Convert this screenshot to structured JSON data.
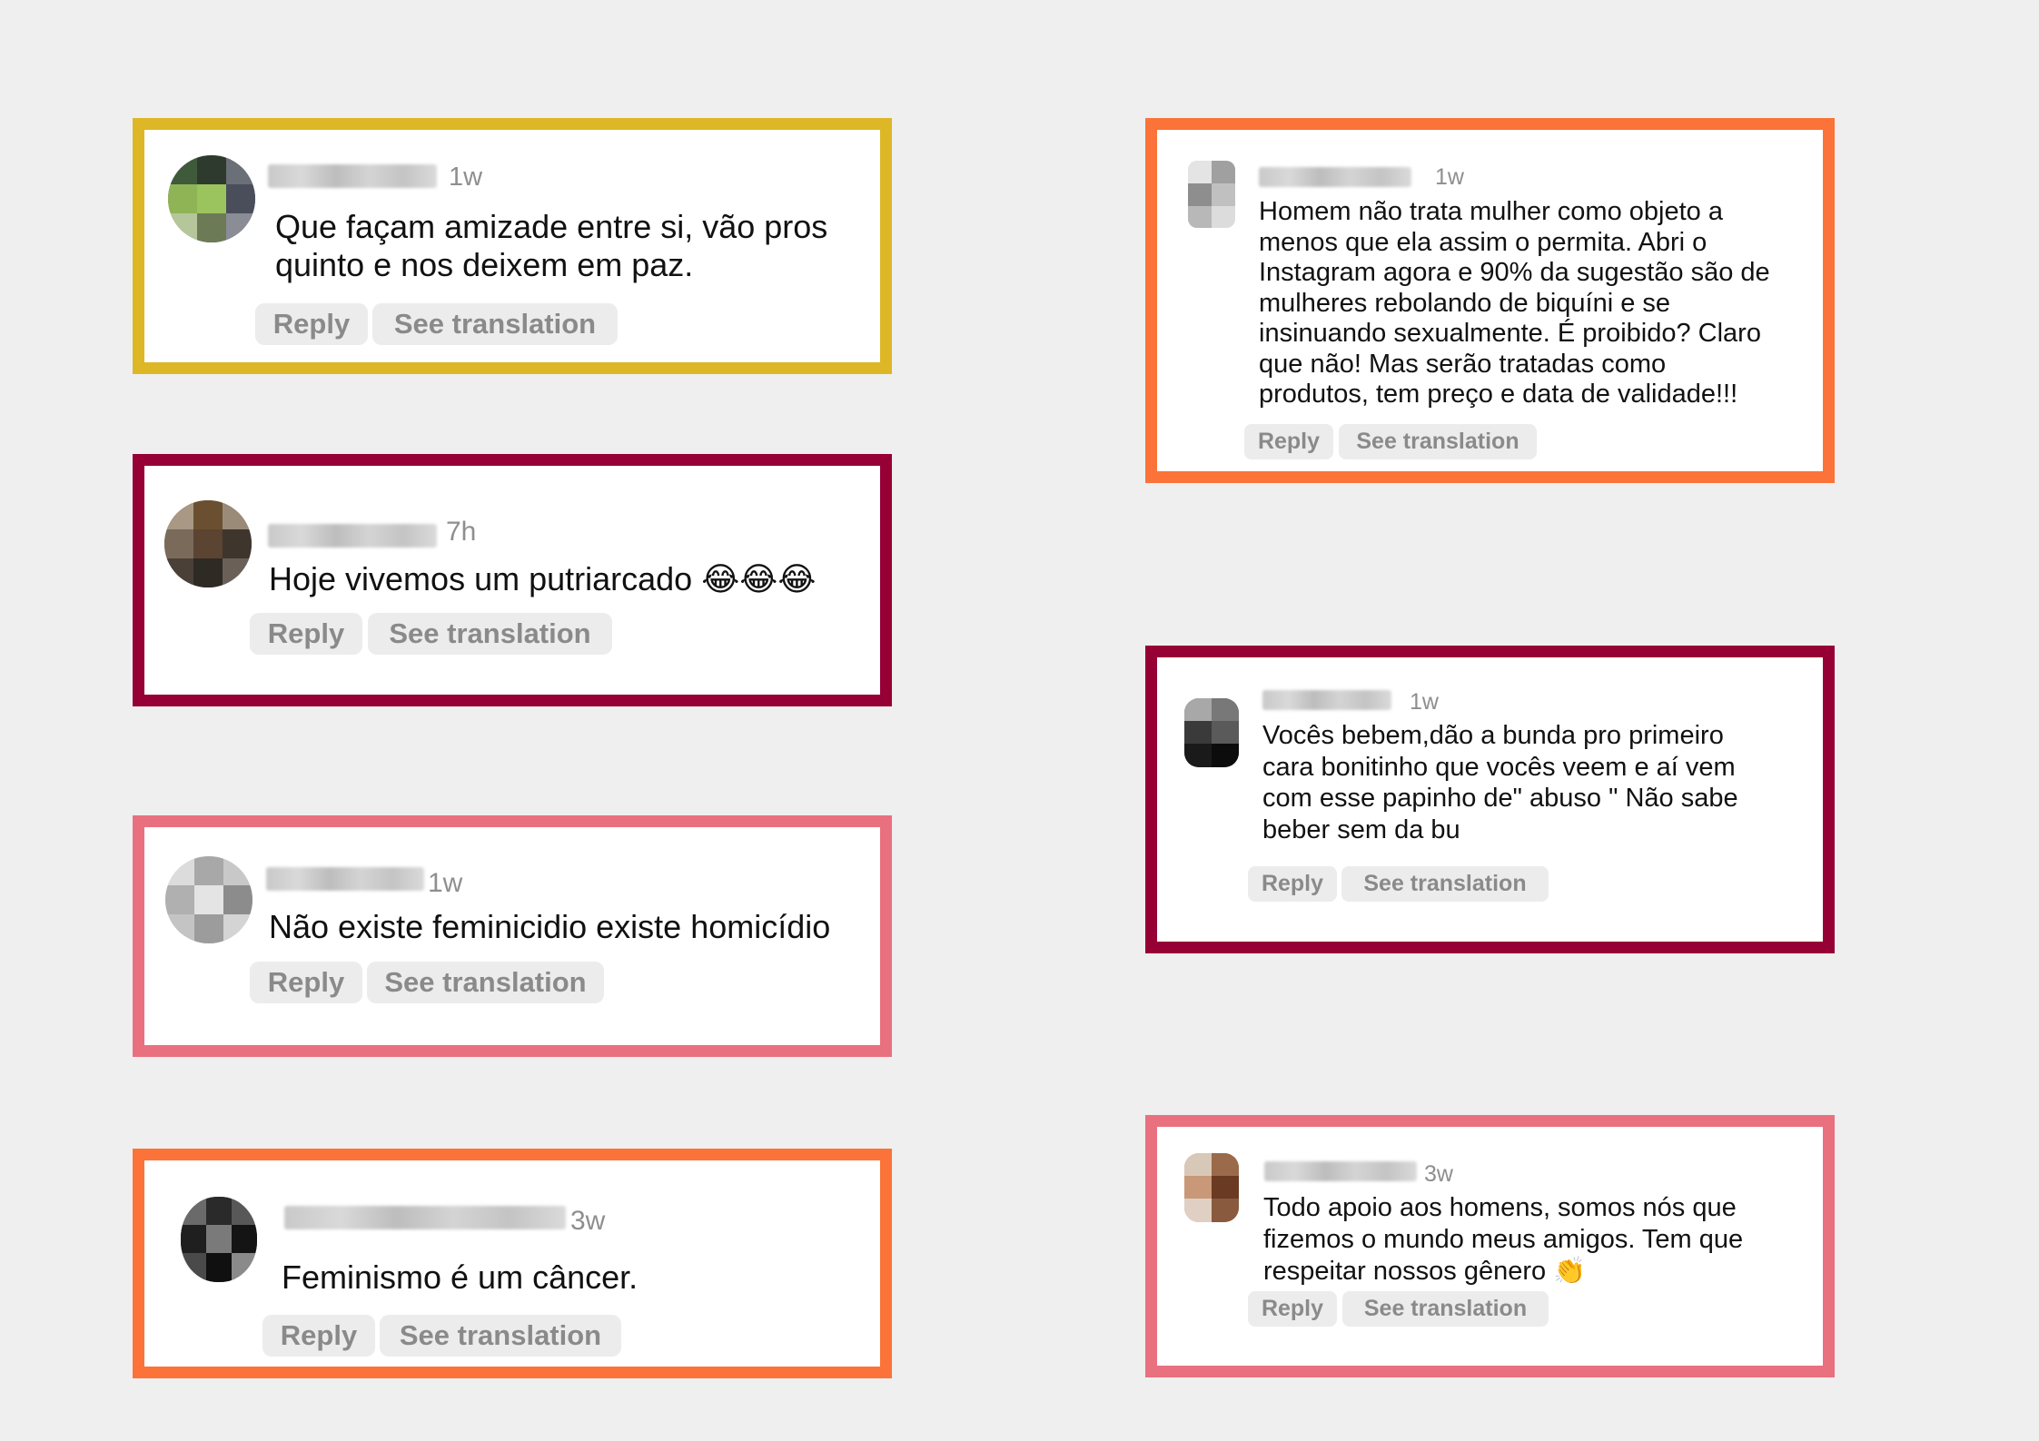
{
  "colors": {
    "background": "#efefef",
    "yellow_frame": "#ddb726",
    "maroon_frame": "#960035",
    "pink_frame": "#e9707f",
    "orange_frame": "#fb7338",
    "pill_bg": "#ececec",
    "meta_text": "#8e8e8e"
  },
  "comments": [
    {
      "frame": "yellow",
      "time": "1w",
      "text": "Que façam amizade entre si, vão pros\nquinto e nos deixem em paz.",
      "reply_label": "Reply",
      "translate_label": "See translation"
    },
    {
      "frame": "maroon",
      "time": "7h",
      "text": "Hoje vivemos um putriarcado 😂😂😂",
      "reply_label": "Reply",
      "translate_label": "See translation"
    },
    {
      "frame": "pink",
      "time": "1w",
      "text": "Não existe feminicidio existe homicídio",
      "reply_label": "Reply",
      "translate_label": "See translation"
    },
    {
      "frame": "orange",
      "time": "3w",
      "text": "Feminismo é um câncer.",
      "reply_label": "Reply",
      "translate_label": "See translation"
    },
    {
      "frame": "orange",
      "time": "1w",
      "text": "Homem não trata mulher como objeto a\nmenos que ela assim o permita. Abri o\nInstagram agora e 90% da sugestão são de\nmulheres rebolando de biquíni e se\ninsinuando sexualmente. É proibido?  Claro\nque não! Mas serão tratadas como\nprodutos, tem preço e data de validade!!!",
      "reply_label": "Reply",
      "translate_label": "See translation"
    },
    {
      "frame": "maroon",
      "time": "1w",
      "text": "Vocês bebem,dão a  bunda pro primeiro\ncara bonitinho que vocês veem e aí vem\ncom esse papinho de\" abuso \" Não sabe\nbeber sem da bu",
      "reply_label": "Reply",
      "translate_label": "See translation"
    },
    {
      "frame": "pink",
      "time": "3w",
      "text": "Todo apoio aos homens, somos nós que\nfizemos o mundo meus amigos. Tem que\nrespeitar nossos gênero 👏",
      "reply_label": "Reply",
      "translate_label": "See translation"
    }
  ]
}
